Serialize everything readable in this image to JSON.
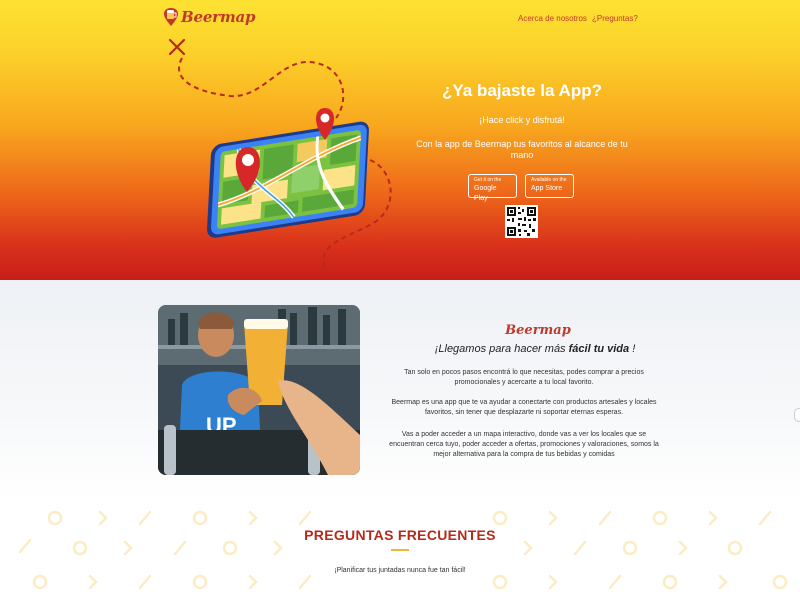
{
  "nav": {
    "logo_text": "Beermap",
    "links": [
      "Acerca de nosotros",
      "¿Preguntas?"
    ]
  },
  "hero": {
    "title": "¿Ya bajaste la App?",
    "subtitle": "¡Hace click y disfrutá!",
    "description": "Con la app de Beermap tus favoritos al alcance de tu mano",
    "google_play": {
      "small": "Get it on the",
      "big": "Google Play"
    },
    "app_store": {
      "small": "Available on the",
      "big": "App Store"
    }
  },
  "about": {
    "logo_text": "Beermap",
    "tagline_pre": "¡Llegamos para hacer más ",
    "tagline_bold": "fácil tu vida",
    "tagline_post": " !",
    "paragraphs": [
      "Tan solo en pocos pasos encontrá lo que necesitas, podes comprar a precios promocionales y acercarte a tu local favorito.",
      "Beermap es una app que te va ayudar a conectarte con productos artesales y locales favoritos, sin tener que desplazarte ni soportar eternas esperas.",
      "Vas a poder acceder a un mapa interactivo, donde vas a ver los locales que se encuentran cerca tuyo, poder acceder a ofertas, promociones y valoraciones, somos la mejor alternativa para la compra de tus bebidas y comidas"
    ]
  },
  "faq": {
    "title": "PREGUNTAS FRECUENTES",
    "subtitle": "¡Planificar tus juntadas nunca fue tan fácil!"
  },
  "colors": {
    "brand_red": "#c0392b",
    "hero_top": "#fde232",
    "hero_bottom": "#c71e1a",
    "accent_gold": "#f2b43a"
  },
  "icons": [
    "beer-pin-logo-icon",
    "map-phone-illustration",
    "qr-code",
    "location-pin-icon"
  ]
}
